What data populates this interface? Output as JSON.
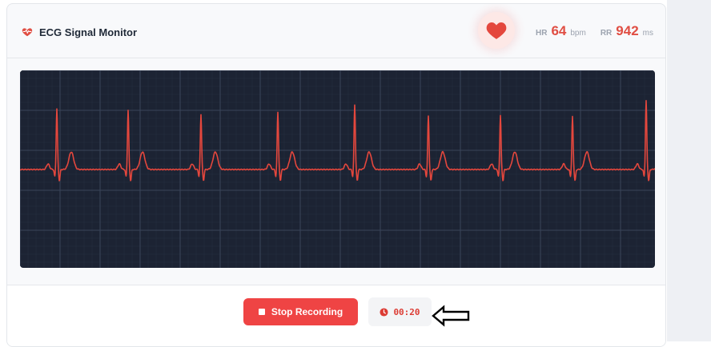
{
  "header": {
    "title": "ECG Signal Monitor",
    "vitals": [
      {
        "label": "HR",
        "value": "64",
        "unit": "bpm"
      },
      {
        "label": "RR",
        "value": "942",
        "unit": "ms"
      }
    ]
  },
  "footer": {
    "stop_button_label": "Stop Recording",
    "timer": "00:20"
  },
  "colors": {
    "accent": "#ef4444",
    "trace": "#e4473d",
    "monitor_bg": "#1c2333",
    "grid": "#3a4459"
  },
  "icons": {
    "title": "heart-pulse-icon",
    "status": "heart-icon",
    "timer": "clock-icon",
    "annotation": "arrow-left-outline-icon",
    "button": "stop-square-icon"
  }
}
